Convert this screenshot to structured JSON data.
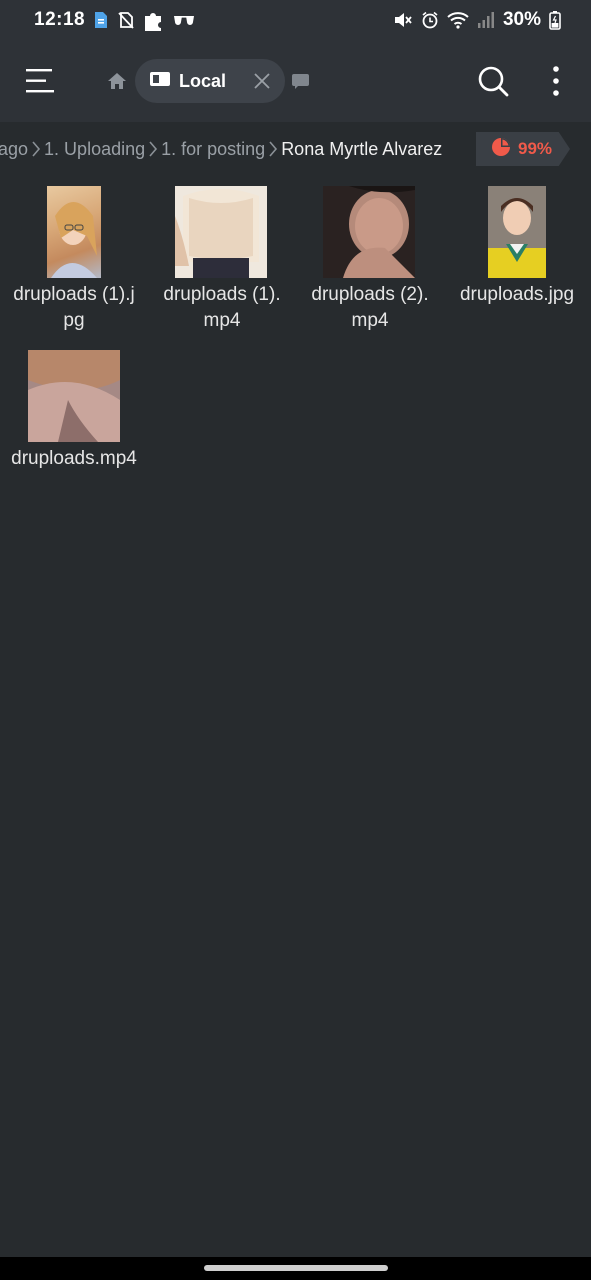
{
  "status_bar": {
    "time": "12:18",
    "battery": "30%",
    "icons": [
      "file-notification-icon",
      "no-sim-icon",
      "puzzle-icon",
      "glasses-icon",
      "mute-icon",
      "alarm-icon",
      "wifi-icon",
      "signal-icon",
      "battery-icon"
    ]
  },
  "toolbar": {
    "tab_label": "Local",
    "icons": [
      "menu-icon",
      "home-icon",
      "folder-icon",
      "close-icon",
      "tab-icon",
      "search-icon",
      "more-vertical-icon"
    ]
  },
  "breadcrumb": {
    "items": [
      "ago",
      "1. Uploading",
      "1. for posting",
      "Rona Myrtle Alvarez"
    ],
    "separator_icon": "chevron-right-icon"
  },
  "storage": {
    "percent": "99%",
    "icon": "pie-chart-icon",
    "color": "#f05a4a"
  },
  "files": [
    {
      "name": "druploads (1).jpg",
      "type": "image"
    },
    {
      "name": "druploads (1).mp4",
      "type": "video"
    },
    {
      "name": "druploads (2).mp4",
      "type": "video"
    },
    {
      "name": "druploads.jpg",
      "type": "image"
    },
    {
      "name": "druploads.mp4",
      "type": "video"
    }
  ],
  "colors": {
    "background": "#272b2e",
    "toolbar": "#2e3237",
    "accent_red": "#f05a4a"
  }
}
